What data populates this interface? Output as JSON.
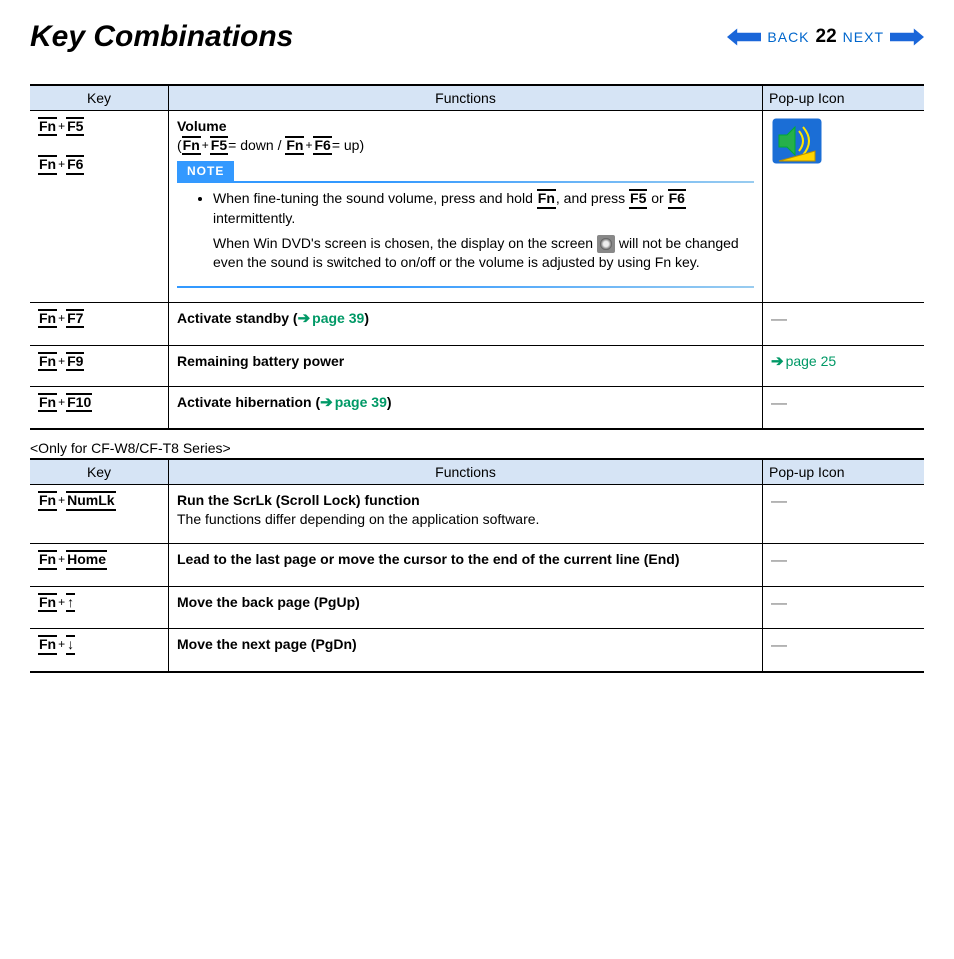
{
  "header": {
    "title": "Key Combinations",
    "back": "BACK",
    "next": "NEXT",
    "page": "22"
  },
  "tableHeaders": {
    "key": "Key",
    "func": "Functions",
    "icon": "Pop-up Icon"
  },
  "table1": {
    "r0": {
      "k1a": "Fn",
      "k1b": "F5",
      "k2a": "Fn",
      "k2b": "F6",
      "title": "Volume",
      "p_open": "(",
      "p_k1a": "Fn",
      "p_k1b": "F5",
      "p_mid1": "= down / ",
      "p_k2a": "Fn",
      "p_k2b": "F6",
      "p_mid2": "= up)",
      "noteLabel": "NOTE",
      "bullet_a": "When fine-tuning the sound volume, press and hold ",
      "bullet_fn": "Fn",
      "bullet_b": ", and press ",
      "bullet_f5": "F5",
      "bullet_c": " or ",
      "bullet_f6": "F6",
      "bullet_d": " intermittently.",
      "para_a": "When Win DVD's screen is chosen, the display on the screen ",
      "para_b": " will not be changed even the sound is switched to on/off or the volume is adjusted by using Fn key."
    },
    "r1": {
      "k1": "Fn",
      "k2": "F7",
      "func": "Activate standby (",
      "link": "page 39",
      "close": ")"
    },
    "r2": {
      "k1": "Fn",
      "k2": "F9",
      "func": "Remaining battery power",
      "link": "page 25"
    },
    "r3": {
      "k1": "Fn",
      "k2": "F10",
      "func": "Activate hibernation (",
      "link": "page 39",
      "close": ")"
    }
  },
  "seriesNote": "<Only for CF-W8/CF-T8 Series>",
  "table2": {
    "r0": {
      "k1": "Fn",
      "k2": "NumLk",
      "func": "Run the ScrLk (Scroll Lock) function",
      "sub": "The functions differ depending on the application software."
    },
    "r1": {
      "k1": "Fn",
      "k2": "Home",
      "func": "Lead to the last page or move the cursor to the end of the current line (End)"
    },
    "r2": {
      "k1": "Fn",
      "arrow": "↑",
      "func": "Move the back page (PgUp)"
    },
    "r3": {
      "k1": "Fn",
      "arrow": "↓",
      "func": "Move the next page (PgDn)"
    }
  }
}
